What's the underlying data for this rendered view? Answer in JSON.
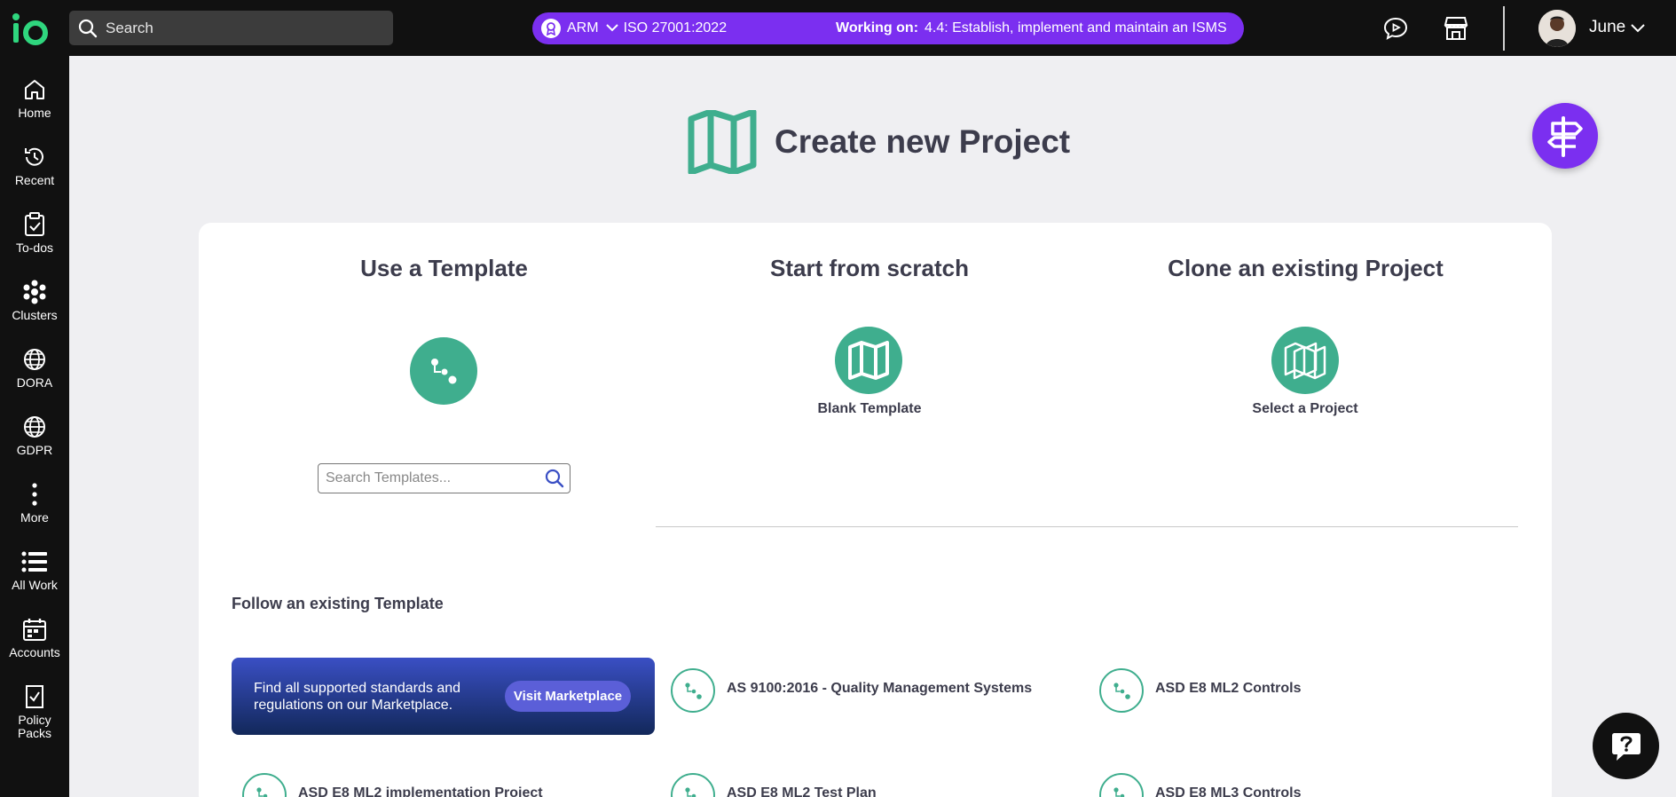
{
  "topbar": {
    "logo_text": "io",
    "search_placeholder": "Search",
    "context": {
      "framework_abbr": "ARM",
      "standard": "ISO 27001:2022",
      "working_on_label": "Working on:",
      "working_on_task": "4.4: Establish, implement and maintain an ISMS",
      "pill_color": "#7b2ff0"
    },
    "user_name": "June"
  },
  "sidebar": {
    "items": [
      {
        "label": "Home",
        "icon": "home-icon"
      },
      {
        "label": "Recent",
        "icon": "history-icon"
      },
      {
        "label": "To-dos",
        "icon": "clipboard-check-icon"
      },
      {
        "label": "Clusters",
        "icon": "clusters-icon"
      },
      {
        "label": "DORA",
        "icon": "globe-icon"
      },
      {
        "label": "GDPR",
        "icon": "globe-icon"
      },
      {
        "label": "More",
        "icon": "more-vertical-icon"
      },
      {
        "label": "All Work",
        "icon": "list-icon"
      },
      {
        "label": "Accounts",
        "icon": "calendar-icon"
      },
      {
        "label": "Policy Packs",
        "icon": "policy-icon"
      }
    ]
  },
  "main": {
    "page_title": "Create new Project",
    "options": {
      "template": {
        "title": "Use a Template",
        "search_placeholder": "Search Templates..."
      },
      "scratch": {
        "title": "Start from scratch",
        "label": "Blank Template"
      },
      "clone": {
        "title": "Clone an existing Project",
        "label": "Select a Project"
      }
    },
    "follow_section": {
      "title": "Follow an existing Template",
      "marketplace_text": "Find all supported standards and regulations on our Marketplace.",
      "marketplace_button": "Visit Marketplace",
      "templates": [
        "AS 9100:2016 - Quality Management Systems",
        "ASD E8 ML2 Controls",
        "ASD E8 ML2 implementation Project",
        "ASD E8 ML2 Test Plan",
        "ASD E8 ML3 Controls"
      ]
    }
  },
  "colors": {
    "accent_green": "#3fae8e",
    "accent_purple": "#7b2ff0",
    "sidebar_bg": "#111111"
  }
}
